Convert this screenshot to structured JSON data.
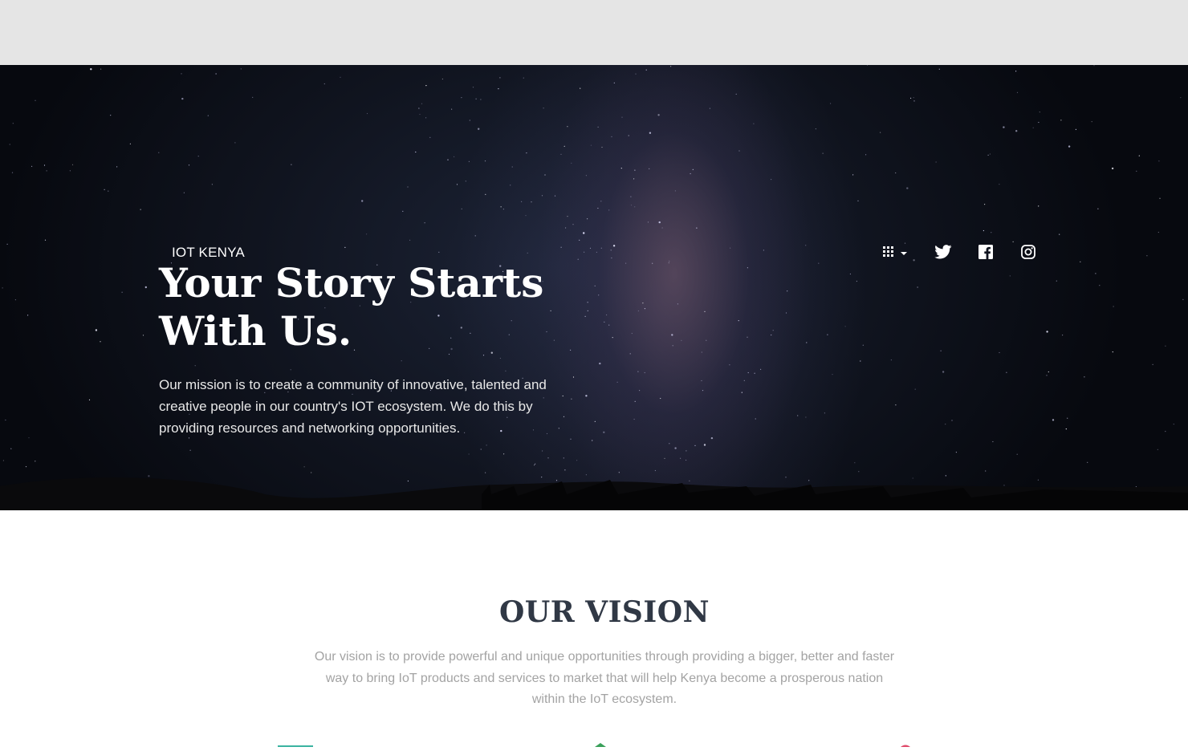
{
  "hero": {
    "brand": "IOT KENYA",
    "headline": "Your Story Starts With Us.",
    "mission": "Our mission is to create a community of innovative, talented and creative people in our country's IOT ecosystem. We do this by providing resources and networking opportunities."
  },
  "social": {
    "items": [
      {
        "icon": "apps-grid-icon"
      },
      {
        "icon": "twitter-icon"
      },
      {
        "icon": "facebook-icon"
      },
      {
        "icon": "instagram-icon"
      }
    ]
  },
  "vision": {
    "title": "OUR VISION",
    "text": "Our vision is to provide powerful and unique opportunities through providing a bigger, better and faster way to bring IoT products and services to market that will help Kenya become a prosperous nation within the IoT ecosystem."
  },
  "colors": {
    "topbar": "#e5e5e5",
    "hero_text": "#ffffff",
    "vision_title": "#303845",
    "vision_text": "#a3a3a3",
    "feature_teal": "#3ab3a0",
    "feature_green": "#3aa05a",
    "feature_pink": "#e04a6a"
  }
}
